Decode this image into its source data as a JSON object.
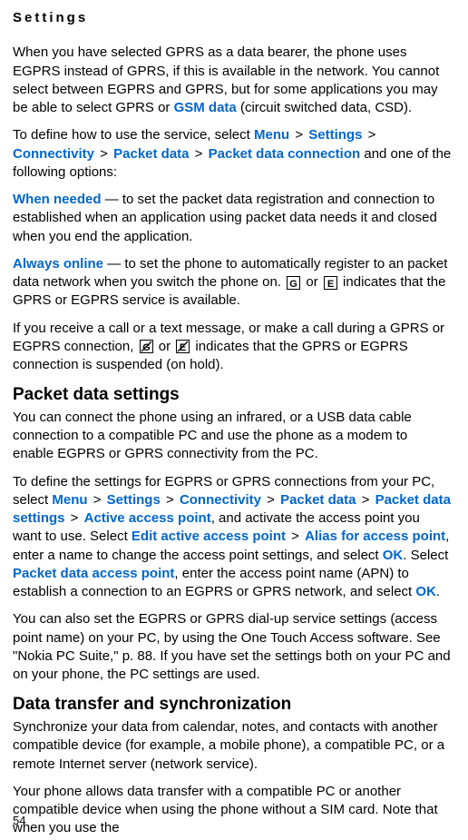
{
  "header": {
    "title": "Settings"
  },
  "p1": {
    "t1": "When you have selected GPRS as a data bearer, the phone uses EGPRS instead of GPRS, if this is available in the network. You cannot select between EGPRS and GPRS, but for some applications you may be able to select GPRS or ",
    "term1": "GSM data",
    "t2": " (circuit switched data, CSD)."
  },
  "p2": {
    "t1": "To define how to use the service, select ",
    "term1": "Menu",
    "term2": "Settings",
    "term3": "Connectivity",
    "term4": "Packet data",
    "term5": "Packet data connection",
    "t2": " and one of the following options:"
  },
  "p3": {
    "term1": "When needed",
    "t1": " — to set the packet data registration and connection to established when an application using packet data needs it and closed when you end the application."
  },
  "p4": {
    "term1": "Always online",
    "t1": " — to set the phone to automatically register to an packet data network when you switch the phone on. ",
    "t2": " or ",
    "t3": " indicates that the GPRS or EGPRS service is available."
  },
  "p5": {
    "t1": "If you receive a call or a text message, or make a call during a GPRS or EGPRS connection, ",
    "t2": " or ",
    "t3": " indicates that the GPRS or EGPRS connection is suspended (on hold)."
  },
  "h2a": "Packet data settings",
  "p6": {
    "t1": "You can connect the phone using an infrared, or a USB data cable connection to a compatible PC and use the phone as a modem to enable EGPRS or GPRS connectivity from the PC."
  },
  "p7": {
    "t1": "To define the settings for EGPRS or GPRS connections from your PC, select ",
    "term1": "Menu",
    "term2": "Settings",
    "term3": "Connectivity",
    "term4": "Packet data",
    "term5": "Packet data settings",
    "term6": "Active access point",
    "t2": ", and activate the access point you want to use. Select ",
    "term7": "Edit active access point",
    "term8": "Alias for access point",
    "t3": ", enter a name to change the access point settings, and select ",
    "term9": "OK",
    "t4": ". Select ",
    "term10": "Packet data access point",
    "t5": ", enter the access point name (APN) to establish a connection to an EGPRS or GPRS network, and select ",
    "term11": "OK",
    "t6": "."
  },
  "p8": {
    "t1": "You can also set the EGPRS or GPRS dial-up service settings (access point name) on your PC, by using the One Touch Access software. See \"Nokia PC Suite,\" p. 88. If you have set the settings both on your PC and on your phone, the PC settings are used."
  },
  "h2b": "Data transfer and synchronization",
  "p9": {
    "t1": "Synchronize your data from calendar, notes, and contacts with another compatible device (for example, a mobile phone), a compatible PC, or a remote Internet server (network service)."
  },
  "p10": {
    "t1": "Your phone allows data transfer with a compatible PC or another compatible device when using the phone without a SIM card. Note that when you use the"
  },
  "pageNumber": "54"
}
